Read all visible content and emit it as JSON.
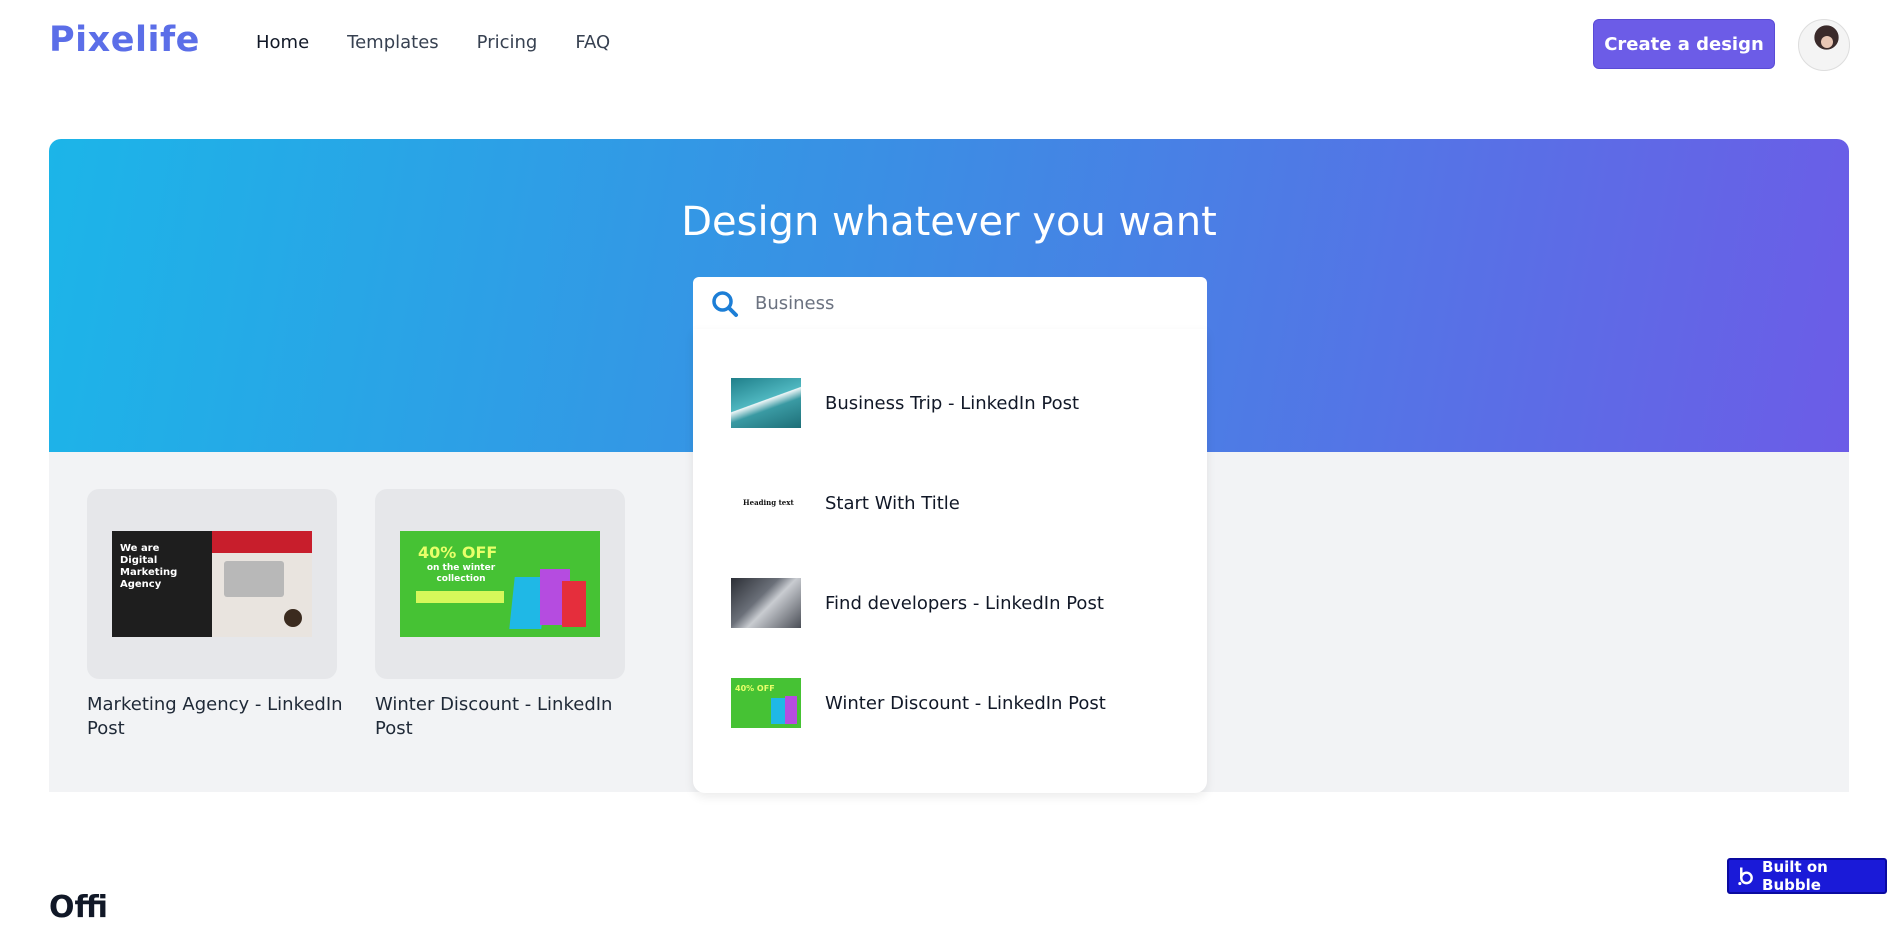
{
  "header": {
    "logo": "Pixelife",
    "nav": [
      "Home",
      "Templates",
      "Pricing",
      "FAQ"
    ],
    "create_label": "Create a design"
  },
  "hero": {
    "title": "Design whatever you want"
  },
  "search": {
    "value": "Business",
    "results": [
      "Business Trip - LinkedIn Post",
      "Start With Title",
      "Find developers - LinkedIn Post",
      "Winter Discount - LinkedIn Post"
    ]
  },
  "cards": [
    {
      "title": "Marketing Agency - LinkedIn Post"
    },
    {
      "title": "Winter Discount - LinkedIn Post"
    }
  ],
  "thumbs": {
    "marketing_text": "We are Digital Marketing Agency",
    "winter_off": "40% OFF",
    "winter_sub": "on the winter collection",
    "start_heading": "Heading text",
    "mini_off": "40% OFF"
  },
  "section": {
    "title": "Offi"
  },
  "bubble": {
    "label": "Built on Bubble"
  },
  "colors": {
    "brand": "#5b6ee8",
    "accent": "#6c5ce7",
    "hero_start": "#1cb5e8",
    "hero_end": "#6c5ce7",
    "bubble": "#1a1ad8"
  }
}
